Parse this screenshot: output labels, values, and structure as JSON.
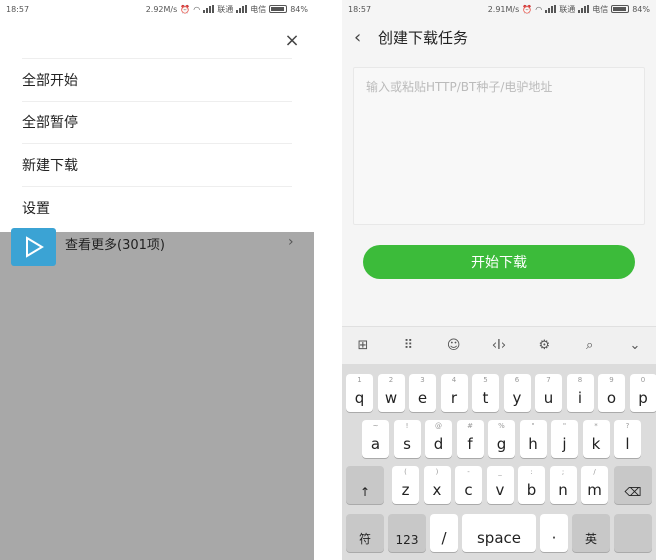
{
  "left": {
    "status": {
      "time": "18:57",
      "speed": "2.92M/s",
      "carrier1": "联通",
      "carrier2": "电信",
      "battery": "84%"
    },
    "close_glyph": "×",
    "menu": [
      {
        "label": "全部开始"
      },
      {
        "label": "全部暂停"
      },
      {
        "label": "新建下载"
      },
      {
        "label": "设置"
      }
    ],
    "more_label": "查看更多(301项)"
  },
  "right": {
    "status": {
      "time": "18:57",
      "speed": "2.91M/s",
      "carrier1": "联通",
      "carrier2": "电信",
      "battery": "84%"
    },
    "title": "创建下载任务",
    "url_placeholder": "输入或粘贴HTTP/BT种子/电驴地址",
    "start_button": "开始下载",
    "keyboard": {
      "row1": [
        [
          "1",
          "q"
        ],
        [
          "2",
          "w"
        ],
        [
          "3",
          "e"
        ],
        [
          "4",
          "r"
        ],
        [
          "5",
          "t"
        ],
        [
          "6",
          "y"
        ],
        [
          "7",
          "u"
        ],
        [
          "8",
          "i"
        ],
        [
          "9",
          "o"
        ],
        [
          "0",
          "p"
        ]
      ],
      "row2": [
        [
          "~",
          "a"
        ],
        [
          "!",
          "s"
        ],
        [
          "@",
          "d"
        ],
        [
          "#",
          "f"
        ],
        [
          "%",
          "g"
        ],
        [
          "\"",
          "h"
        ],
        [
          "\"",
          "j"
        ],
        [
          "*",
          "k"
        ],
        [
          "?",
          "l"
        ]
      ],
      "row3": [
        [
          "(",
          "z"
        ],
        [
          ")",
          "x"
        ],
        [
          "-",
          "c"
        ],
        [
          "_",
          "v"
        ],
        [
          ":",
          "b"
        ],
        [
          ";",
          "n"
        ],
        [
          "/",
          "m"
        ]
      ],
      "shift": "↑",
      "backspace": "⌫",
      "sym": "符",
      "num": "123",
      "slash": "/",
      "space": "space",
      "period": "·",
      "lang": "英"
    }
  }
}
